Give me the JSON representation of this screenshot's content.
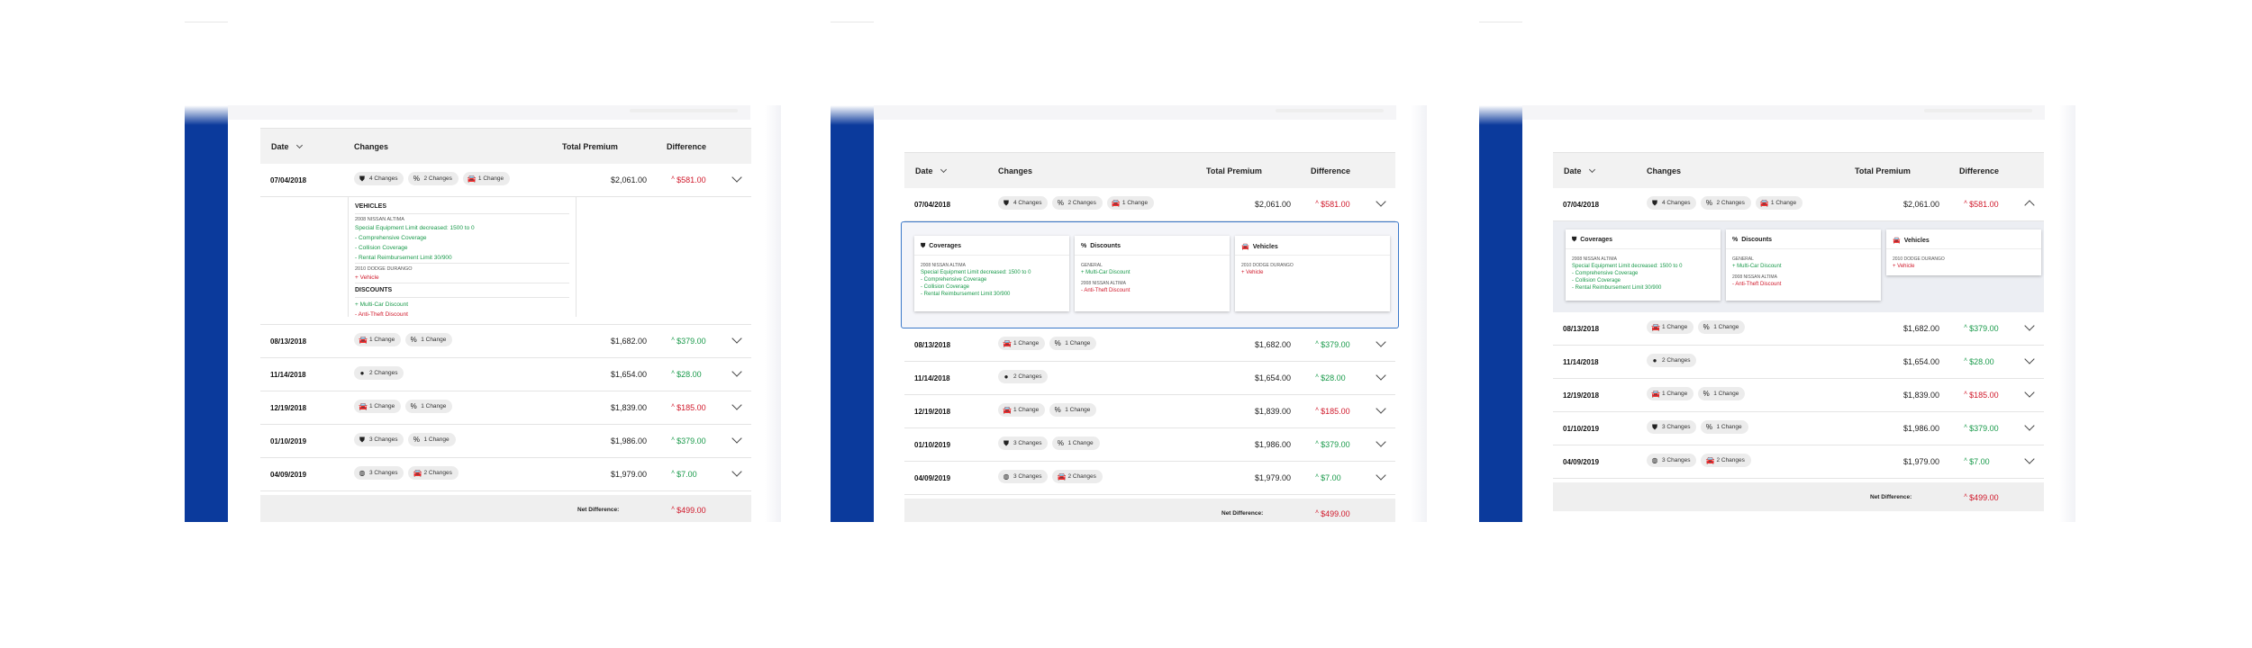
{
  "columns": {
    "date": "Date",
    "changes": "Changes",
    "total_premium": "Total Premium",
    "difference": "Difference"
  },
  "rows": [
    {
      "date": "07/04/2018",
      "premium": "$2,061.00",
      "diff": "$581.00",
      "dir": "up-bad",
      "pills": [
        {
          "icon": "shield-icon",
          "glyph": "⛊",
          "label": "4 Changes"
        },
        {
          "icon": "discount-icon",
          "glyph": "%",
          "label": "2 Changes"
        },
        {
          "icon": "car-icon",
          "glyph": "🚘",
          "label": "1 Change"
        }
      ]
    },
    {
      "date": "08/13/2018",
      "premium": "$1,682.00",
      "diff": "$379.00",
      "dir": "up-good",
      "pills": [
        {
          "icon": "car-icon",
          "glyph": "🚘",
          "label": "1 Change"
        },
        {
          "icon": "discount-icon",
          "glyph": "%",
          "label": "1 Change"
        }
      ]
    },
    {
      "date": "11/14/2018",
      "premium": "$1,654.00",
      "diff": "$28.00",
      "dir": "up-good",
      "pills": [
        {
          "icon": "info-icon",
          "glyph": "●",
          "label": "2 Changes"
        }
      ]
    },
    {
      "date": "12/19/2018",
      "premium": "$1,839.00",
      "diff": "$185.00",
      "dir": "up-bad",
      "pills": [
        {
          "icon": "car-icon",
          "glyph": "🚘",
          "label": "1 Change"
        },
        {
          "icon": "discount-icon",
          "glyph": "%",
          "label": "1 Change"
        }
      ]
    },
    {
      "date": "01/10/2019",
      "premium": "$1,986.00",
      "diff": "$379.00",
      "dir": "up-good",
      "pills": [
        {
          "icon": "shield-icon",
          "glyph": "⛊",
          "label": "3 Changes"
        },
        {
          "icon": "discount-icon",
          "glyph": "%",
          "label": "1 Change"
        }
      ]
    },
    {
      "date": "04/09/2019",
      "premium": "$1,979.00",
      "diff": "$7.00",
      "dir": "up-good",
      "pills": [
        {
          "icon": "globe-icon",
          "glyph": "◍",
          "label": "3 Changes"
        },
        {
          "icon": "car-icon",
          "glyph": "🚘",
          "label": "2 Changes"
        }
      ]
    }
  ],
  "footer": {
    "label": "Net Difference:",
    "value": "$499.00"
  },
  "detail_list": {
    "vehicles_heading": "VEHICLES",
    "vehicle1": "2008 NISSAN ALTIMA",
    "vehicle1_lines": [
      "Special Equipment Limit decreased: 1500 to 0",
      "- Comprehensive Coverage",
      "- Collision Coverage",
      "- Rental Reimbursement Limit 30/900"
    ],
    "vehicle2": "2010 DODGE DURANGO",
    "vehicle2_lines": [
      "+ Vehicle"
    ],
    "discounts_heading": "DISCOUNTS",
    "discount_lines": [
      "+ Multi-Car Discount",
      "- Anti-Theft Discount"
    ]
  },
  "detail_cards": {
    "coverages": {
      "title": "Coverages",
      "sub": "2008 NISSAN ALTIMA",
      "lines": [
        "Special Equipment Limit decreased: 1500 to 0",
        "- Comprehensive Coverage",
        "- Collision Coverage",
        "- Rental Reimbursement Limit 30/900"
      ]
    },
    "discounts": {
      "title": "Discounts",
      "sub1": "GENERAL",
      "lines1": [
        "+ Multi-Car Discount"
      ],
      "sub2": "2008 NISSAN ALTIMA",
      "lines2": [
        "- Anti-Theft Discount"
      ]
    },
    "vehicles": {
      "title": "Vehicles",
      "sub": "2010 DODGE DURANGO",
      "lines": [
        "+ Vehicle"
      ]
    }
  },
  "colors": {
    "rail": "#0b3a9c",
    "positive": "#1a9a4b",
    "negative": "#d0192b",
    "focus": "#3a78c9"
  }
}
